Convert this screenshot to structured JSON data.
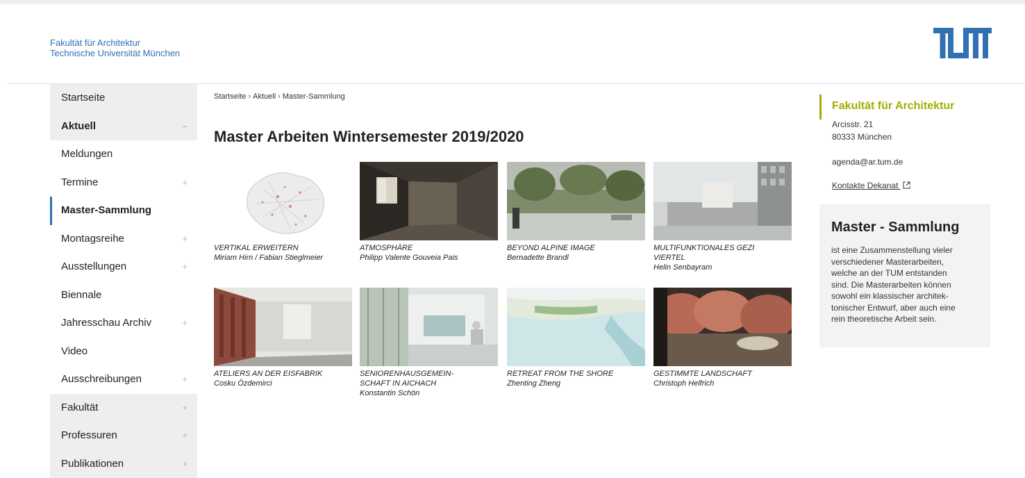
{
  "header": {
    "faculty_line1": "Fakultät für Architektur",
    "faculty_line2": "Technische Universität München",
    "logo_text": "TUM",
    "logo_color": "#3070b3"
  },
  "sidebar": {
    "items": [
      {
        "label": "Startseite",
        "expand": ""
      },
      {
        "label": "Aktuell",
        "expand": "–"
      },
      {
        "label": "Meldungen",
        "expand": ""
      },
      {
        "label": "Termine",
        "expand": "+"
      },
      {
        "label": "Master-Sammlung",
        "expand": ""
      },
      {
        "label": "Montagsreihe",
        "expand": "+"
      },
      {
        "label": "Ausstellungen",
        "expand": "+"
      },
      {
        "label": "Biennale",
        "expand": ""
      },
      {
        "label": "Jahresschau Archiv",
        "expand": "+"
      },
      {
        "label": "Video",
        "expand": ""
      },
      {
        "label": "Ausschreibungen",
        "expand": "+"
      },
      {
        "label": "Fakultät",
        "expand": "+"
      },
      {
        "label": "Professuren",
        "expand": "+"
      },
      {
        "label": "Publikationen",
        "expand": "+"
      }
    ]
  },
  "breadcrumb": {
    "items": [
      "Startseite",
      "Aktuell",
      "Master-Sammlung"
    ],
    "separator": "›"
  },
  "main": {
    "title": "Master Arbeiten Wintersemester 2019/2020",
    "tiles": [
      {
        "title_lines": [
          "VERTIKAL ERWEITERN"
        ],
        "author": "Miriam Hirn / Fabian Stieglmeier"
      },
      {
        "title_lines": [
          "ATMOSPHÄRE"
        ],
        "author": "Philipp Valente Gouveia Pais"
      },
      {
        "title_lines": [
          "BEYOND ALPINE IMAGE"
        ],
        "author": "Bernadette Brandl"
      },
      {
        "title_lines": [
          "MULTIFUNKTIONALES GEZI",
          "VIERTEL"
        ],
        "author": "Helin Senbayram"
      },
      {
        "title_lines": [
          "ATELIERS AN DER EISFABRIK"
        ],
        "author": "Cosku Özdemirci"
      },
      {
        "title_lines": [
          "SENIORENHAUSGEMEIN-",
          "SCHAFT IN AICHACH"
        ],
        "author": "Konstantin Schön"
      },
      {
        "title_lines": [
          "RETREAT FROM THE SHORE"
        ],
        "author": "Zhenting Zheng"
      },
      {
        "title_lines": [
          "GESTIMMTE LANDSCHAFT"
        ],
        "author": "Christoph Helfrich"
      }
    ]
  },
  "contact": {
    "title": "Fakultät für Architektur",
    "street": "Arcisstr. 21",
    "city": "80333 München",
    "email": "agenda@ar.tum.de",
    "link_label": "Kontakte Dekanat",
    "link_icon": "external-link-icon",
    "accent": "#a2ad00"
  },
  "info": {
    "title": "Master - Sammlung",
    "lines": [
      "ist eine Zusammenstellung vieler",
      "verschiedener Masterarbeiten,",
      "welche an der TUM entstanden",
      "sind. Die Masterarbeiten können",
      "sowohl ein klassischer architek-",
      "tonischer Entwurf, aber auch eine",
      "rein theoretische Arbeit sein."
    ]
  }
}
